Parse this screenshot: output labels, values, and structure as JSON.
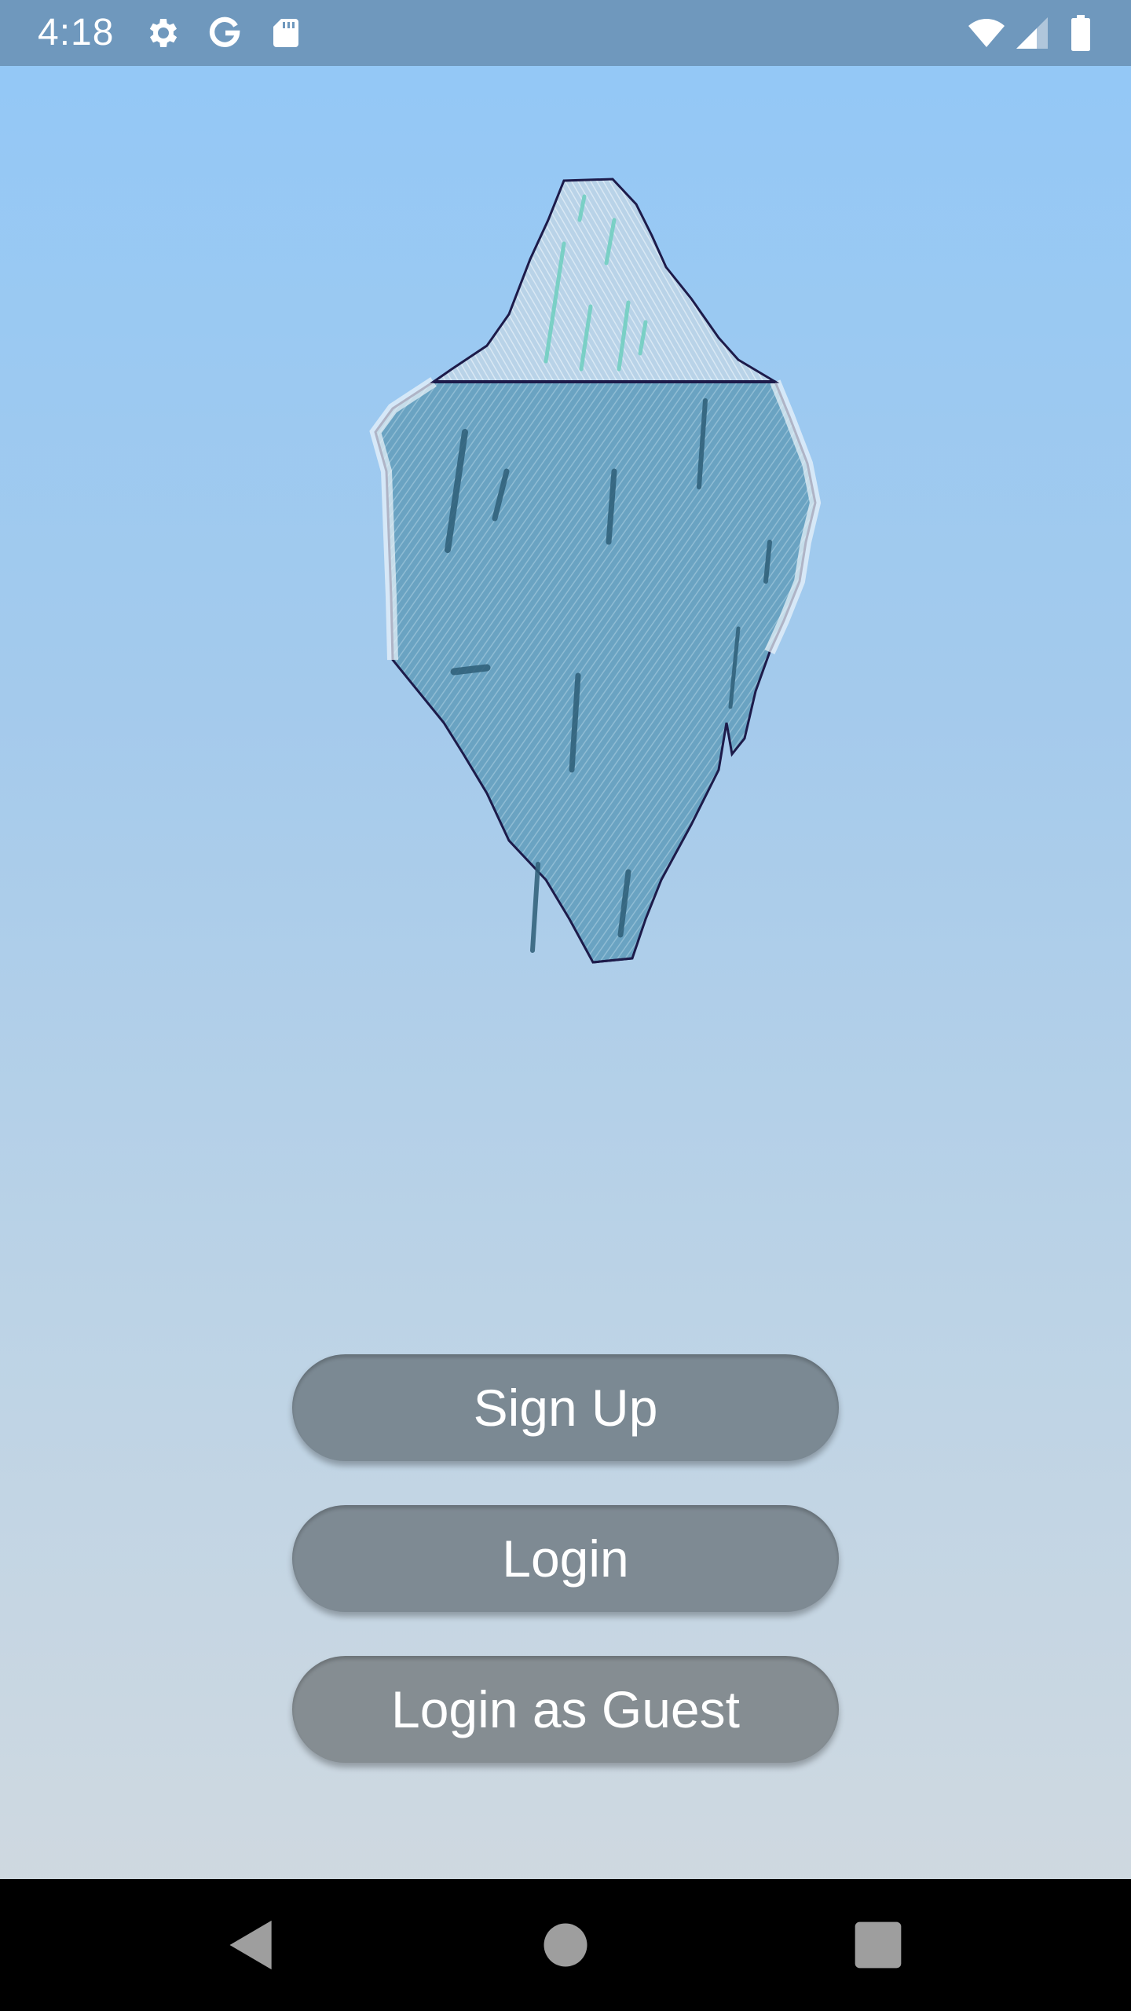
{
  "status_bar": {
    "time": "4:18",
    "icons_left": [
      "gear-icon",
      "google-icon",
      "sd-card-icon"
    ],
    "icons_right": [
      "wifi-icon",
      "cell-signal-icon",
      "battery-icon"
    ],
    "background_color": "#6f98bd"
  },
  "hero": {
    "illustration": "iceberg-illustration"
  },
  "buttons": {
    "signup_label": "Sign Up",
    "login_label": "Login",
    "guest_label": "Login as Guest"
  },
  "nav_bar": {
    "back": "back-icon",
    "home": "home-icon",
    "recents": "recents-icon"
  },
  "colors": {
    "gradient_top": "#92c8f7",
    "gradient_bottom": "#d3dadf",
    "button": "#7e8a93",
    "ice_light": "#c8def0",
    "ice_dark": "#5c98b8",
    "outline": "#1d1b4a"
  }
}
